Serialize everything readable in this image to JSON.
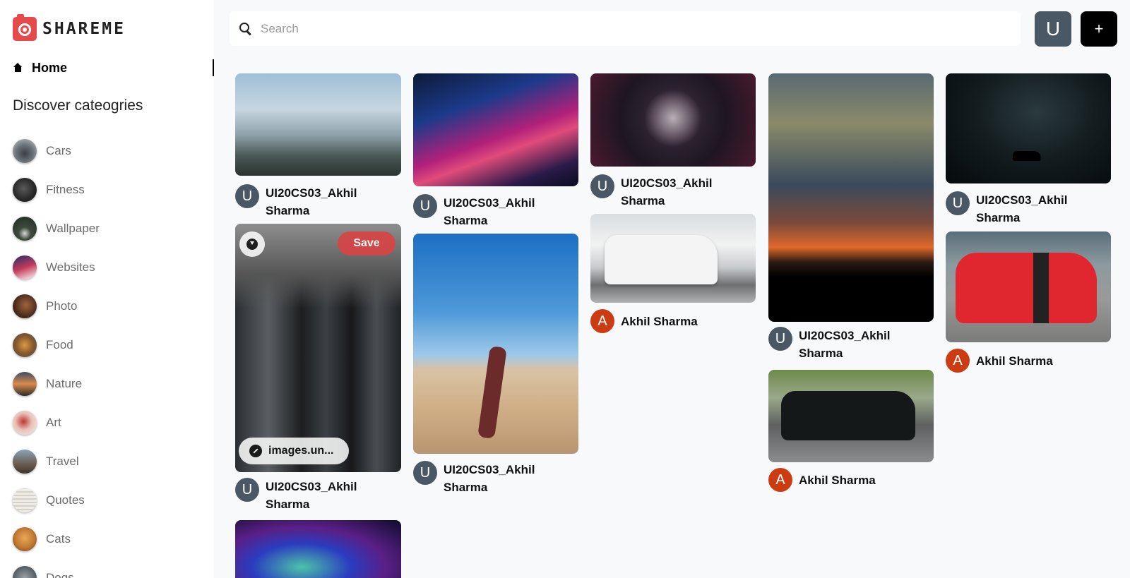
{
  "app": {
    "name": "SHAREME"
  },
  "nav": {
    "home_label": "Home"
  },
  "sidebar": {
    "heading": "Discover cateogries",
    "categories": [
      {
        "label": "Cars"
      },
      {
        "label": "Fitness"
      },
      {
        "label": "Wallpaper"
      },
      {
        "label": "Websites"
      },
      {
        "label": "Photo"
      },
      {
        "label": "Food"
      },
      {
        "label": "Nature"
      },
      {
        "label": "Art"
      },
      {
        "label": "Travel"
      },
      {
        "label": "Quotes"
      },
      {
        "label": "Cats"
      },
      {
        "label": "Dogs"
      }
    ]
  },
  "search": {
    "placeholder": "Search",
    "value": ""
  },
  "header": {
    "user_initial": "U",
    "add_label": "+"
  },
  "pins": [
    {
      "subject": "misty mountains with birds",
      "author": "UI20CS03_Akhil Sharma",
      "author_initial": "U"
    },
    {
      "subject": "gym dumbbell rack",
      "author": "UI20CS03_Akhil Sharma",
      "author_initial": "U",
      "save_label": "Save",
      "link_label": "images.un..."
    },
    {
      "subject": "space nebula",
      "author": "",
      "author_initial": ""
    },
    {
      "subject": "city highway light trails at night",
      "author": "UI20CS03_Akhil Sharma",
      "author_initial": "U"
    },
    {
      "subject": "woman doing yoga pose in desert",
      "author": "UI20CS03_Akhil Sharma",
      "author_initial": "U"
    },
    {
      "subject": "glass sphere render",
      "author": "UI20CS03_Akhil Sharma",
      "author_initial": "U"
    },
    {
      "subject": "white Lamborghini Urus",
      "author": "Akhil Sharma",
      "author_initial": "A"
    },
    {
      "subject": "sunset over dark field",
      "author": "UI20CS03_Akhil Sharma",
      "author_initial": "U"
    },
    {
      "subject": "black classic Mustang",
      "author": "Akhil Sharma",
      "author_initial": "A"
    },
    {
      "subject": "starry night with car silhouette",
      "author": "UI20CS03_Akhil Sharma",
      "author_initial": "U"
    },
    {
      "subject": "red Ford Mustang",
      "author": "Akhil Sharma",
      "author_initial": "A"
    }
  ]
}
